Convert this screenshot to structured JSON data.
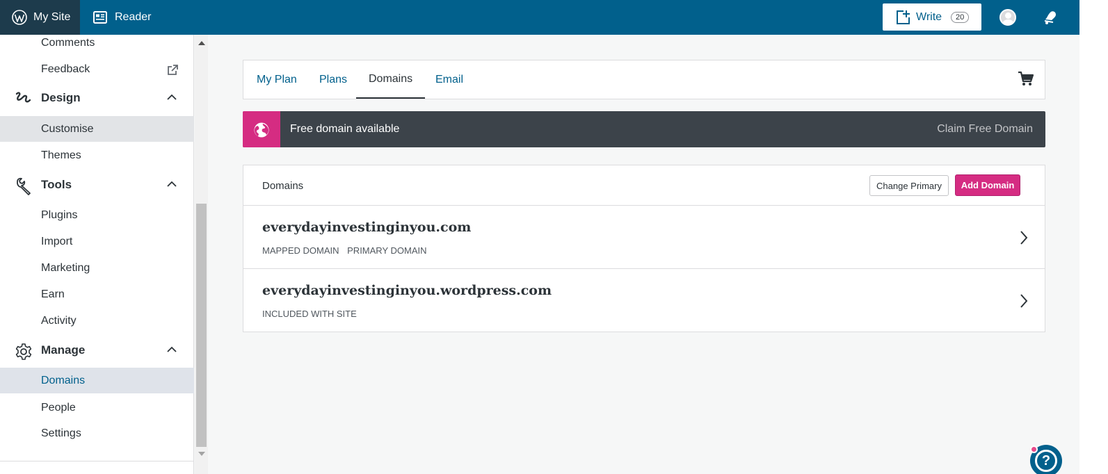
{
  "masterbar": {
    "my_site": "My Site",
    "reader": "Reader",
    "write": "Write",
    "write_count": "20"
  },
  "sidebar": {
    "items": {
      "comments": "Comments",
      "feedback": "Feedback",
      "design": "Design",
      "customise": "Customise",
      "themes": "Themes",
      "tools": "Tools",
      "plugins": "Plugins",
      "import": "Import",
      "marketing": "Marketing",
      "earn": "Earn",
      "activity": "Activity",
      "manage": "Manage",
      "domains": "Domains",
      "people": "People",
      "settings": "Settings"
    }
  },
  "tabs": [
    "My Plan",
    "Plans",
    "Domains",
    "Email"
  ],
  "banner": {
    "text": "Free domain available",
    "cta": "Claim Free Domain"
  },
  "domains_card": {
    "title": "Domains",
    "change_primary": "Change Primary",
    "add_domain": "Add Domain",
    "rows": [
      {
        "name": "everydayinvestinginyou.com",
        "tag1": "MAPPED DOMAIN",
        "tag2": "PRIMARY DOMAIN"
      },
      {
        "name": "everydayinvestinginyou.wordpress.com",
        "tag1": "INCLUDED WITH SITE",
        "tag2": ""
      }
    ]
  },
  "help": {
    "symbol": "?"
  },
  "colors": {
    "masterbar": "#01608c",
    "accent_pink": "#d52c82",
    "banner_dark": "#3c434a",
    "link_blue": "#01608c"
  }
}
